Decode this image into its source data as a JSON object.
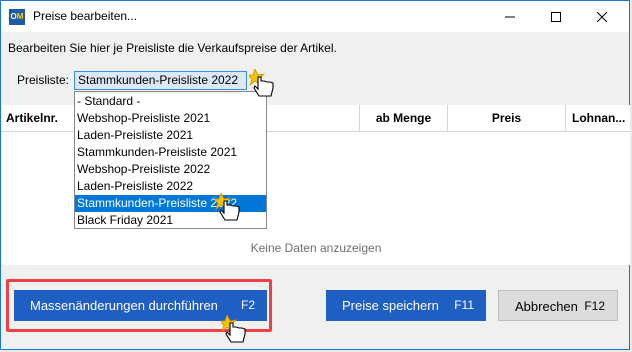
{
  "window": {
    "title": "Preise bearbeiten...",
    "app_icon": {
      "left": "O",
      "right": "M"
    },
    "controls": {
      "minimize": "minimize-icon",
      "maximize": "maximize-icon",
      "close": "close-icon"
    }
  },
  "description": "Bearbeiten Sie hier je Preisliste die Verkaufspreise der Artikel.",
  "pricelist": {
    "label": "Preisliste:",
    "selected": "Stammkunden-Preisliste 2022",
    "options": [
      "- Standard -",
      "Webshop-Preisliste 2021",
      "Laden-Preisliste 2021",
      "Stammkunden-Preisliste 2021",
      "Webshop-Preisliste 2022",
      "Laden-Preisliste 2022",
      "Stammkunden-Preisliste 2022",
      "Black Friday 2021"
    ],
    "highlighted_index": 6
  },
  "table": {
    "columns": [
      "Artikelnr.",
      "ab Menge",
      "Preis",
      "Lohnan..."
    ],
    "empty_text": "Keine Daten anzuzeigen"
  },
  "buttons": {
    "mass_change": {
      "label": "Massenänderungen durchführen",
      "shortcut": "F2"
    },
    "save": {
      "label": "Preise speichern",
      "shortcut": "F11"
    },
    "cancel": {
      "label": "Abbrechen",
      "shortcut": "F12"
    }
  },
  "colors": {
    "accent": "#1f5ec2",
    "selection": "#0078d7",
    "highlight_frame": "#ec4147"
  }
}
